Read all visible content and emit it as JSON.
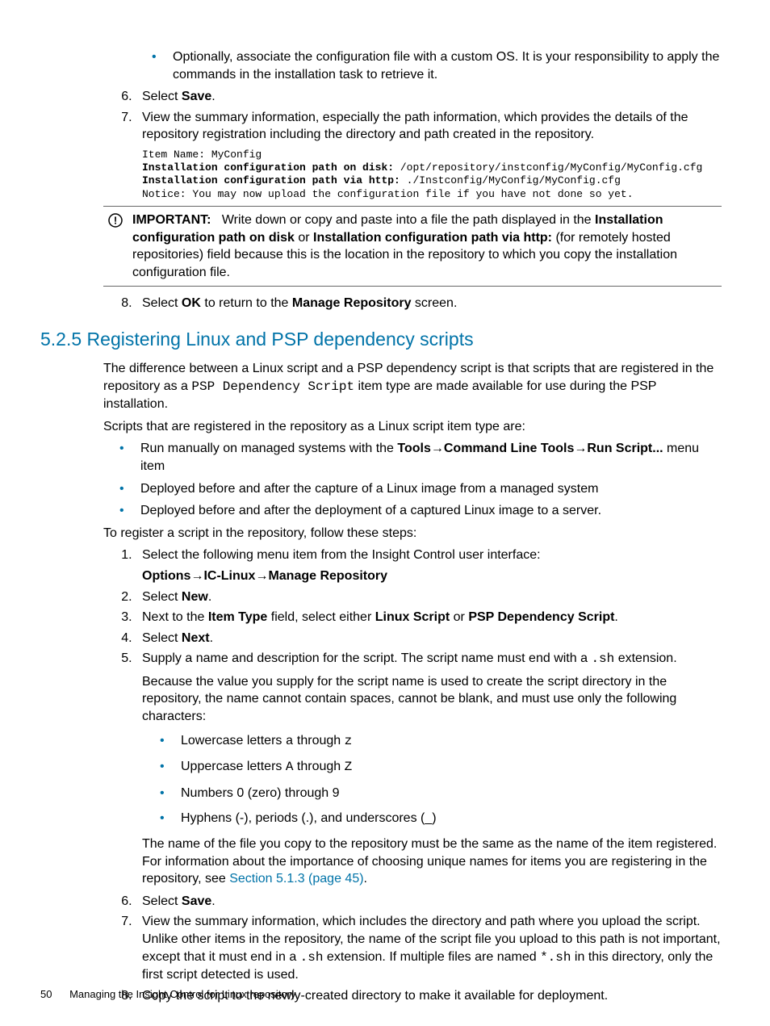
{
  "top": {
    "bullet_optional": "Optionally, associate the configuration file with a custom OS. It is your responsibility to apply the commands in the installation task to retrieve it.",
    "li6_a": "Select ",
    "li6_b": "Save",
    "li6_c": ".",
    "li7": "View the summary information, especially the path information, which provides the details of the repository registration including the directory and path created in the repository.",
    "code_l1": "Item Name: MyConfig",
    "code_l2a": "Installation configuration path on disk:",
    "code_l2b": " /opt/repository/instconfig/MyConfig/MyConfig.cfg",
    "code_l3a": "Installation configuration path via http:",
    "code_l3b": " ./Instconfig/MyConfig/MyConfig.cfg",
    "code_l4": "Notice: You may now upload the configuration file if you have not done so yet.",
    "important_label": "IMPORTANT:",
    "important_a": "Write down or copy and paste into a file the path displayed in the ",
    "important_b": "Installation configuration path on disk",
    "important_c": " or ",
    "important_d": "Installation configuration path via http:",
    "important_e": " (for remotely hosted repositories) field because this is the location in the repository to which you copy the installation configuration file.",
    "li8_a": "Select ",
    "li8_b": "OK",
    "li8_c": " to return to the ",
    "li8_d": "Manage Repository",
    "li8_e": " screen."
  },
  "section": {
    "num": "5.2.5",
    "title": "Registering Linux and PSP dependency scripts",
    "p1_a": "The difference between a Linux script and a PSP dependency script is that scripts that are registered in the repository as a ",
    "p1_b": "PSP Dependency Script",
    "p1_c": " item type are made available for use during the PSP installation.",
    "p2": "Scripts that are registered in the repository as a Linux script item type are:",
    "b1_a": "Run manually on managed systems with the ",
    "b1_b": "Tools",
    "b1_c": "Command Line Tools",
    "b1_d": "Run Script...",
    "b1_e": " menu item",
    "b2": "Deployed before and after the capture of a Linux image from a managed system",
    "b3": "Deployed before and after the deployment of a captured Linux image to a server.",
    "p3": "To register a script in the repository, follow these steps:",
    "s1": "Select the following menu item from the Insight Control user interface:",
    "s1m_a": "Options",
    "s1m_b": "IC-Linux",
    "s1m_c": "Manage Repository",
    "s2_a": "Select ",
    "s2_b": "New",
    "s2_c": ".",
    "s3_a": "Next to the ",
    "s3_b": "Item Type",
    "s3_c": " field, select either ",
    "s3_d": "Linux Script",
    "s3_e": " or ",
    "s3_f": "PSP Dependency Script",
    "s3_g": ".",
    "s4_a": "Select ",
    "s4_b": "Next",
    "s4_c": ".",
    "s5_a": "Supply a name and description for the script. The script name must end with a ",
    "s5_b": ".sh",
    "s5_c": " extension.",
    "s5p": "Because the value you supply for the script name is used to create the script directory in the repository, the name cannot contain spaces, cannot be blank, and must use only the following characters:",
    "s5b1_a": "Lowercase letters ",
    "s5b1_b": "a",
    "s5b1_c": " through ",
    "s5b1_d": "z",
    "s5b2_a": "Uppercase letters ",
    "s5b2_b": "A",
    "s5b2_c": " through ",
    "s5b2_d": "Z",
    "s5b3": "Numbers 0 (zero) through 9",
    "s5b4": "Hyphens (-), periods (.), and underscores (_)",
    "s5p2_a": "The name of the file you copy to the repository must be the same as the name of the item registered. For information about the importance of choosing unique names for items you are registering in the repository, see ",
    "s5p2_link": "Section 5.1.3 (page 45)",
    "s5p2_b": ".",
    "s6_a": "Select ",
    "s6_b": "Save",
    "s6_c": ".",
    "s7_a": "View the summary information, which includes the directory and path where you upload the script. Unlike other items in the repository, the name of the script file you upload to this path is not important, except that it must end in a ",
    "s7_b": ".sh",
    "s7_c": " extension. If multiple files are named ",
    "s7_d": "*.sh",
    "s7_e": " in this directory, only the first script detected is used.",
    "s8": "Copy the script to the newly-created directory to make it available for deployment."
  },
  "footer": {
    "page": "50",
    "title": "Managing the Insight Control for Linux repository"
  },
  "arrow": "→"
}
